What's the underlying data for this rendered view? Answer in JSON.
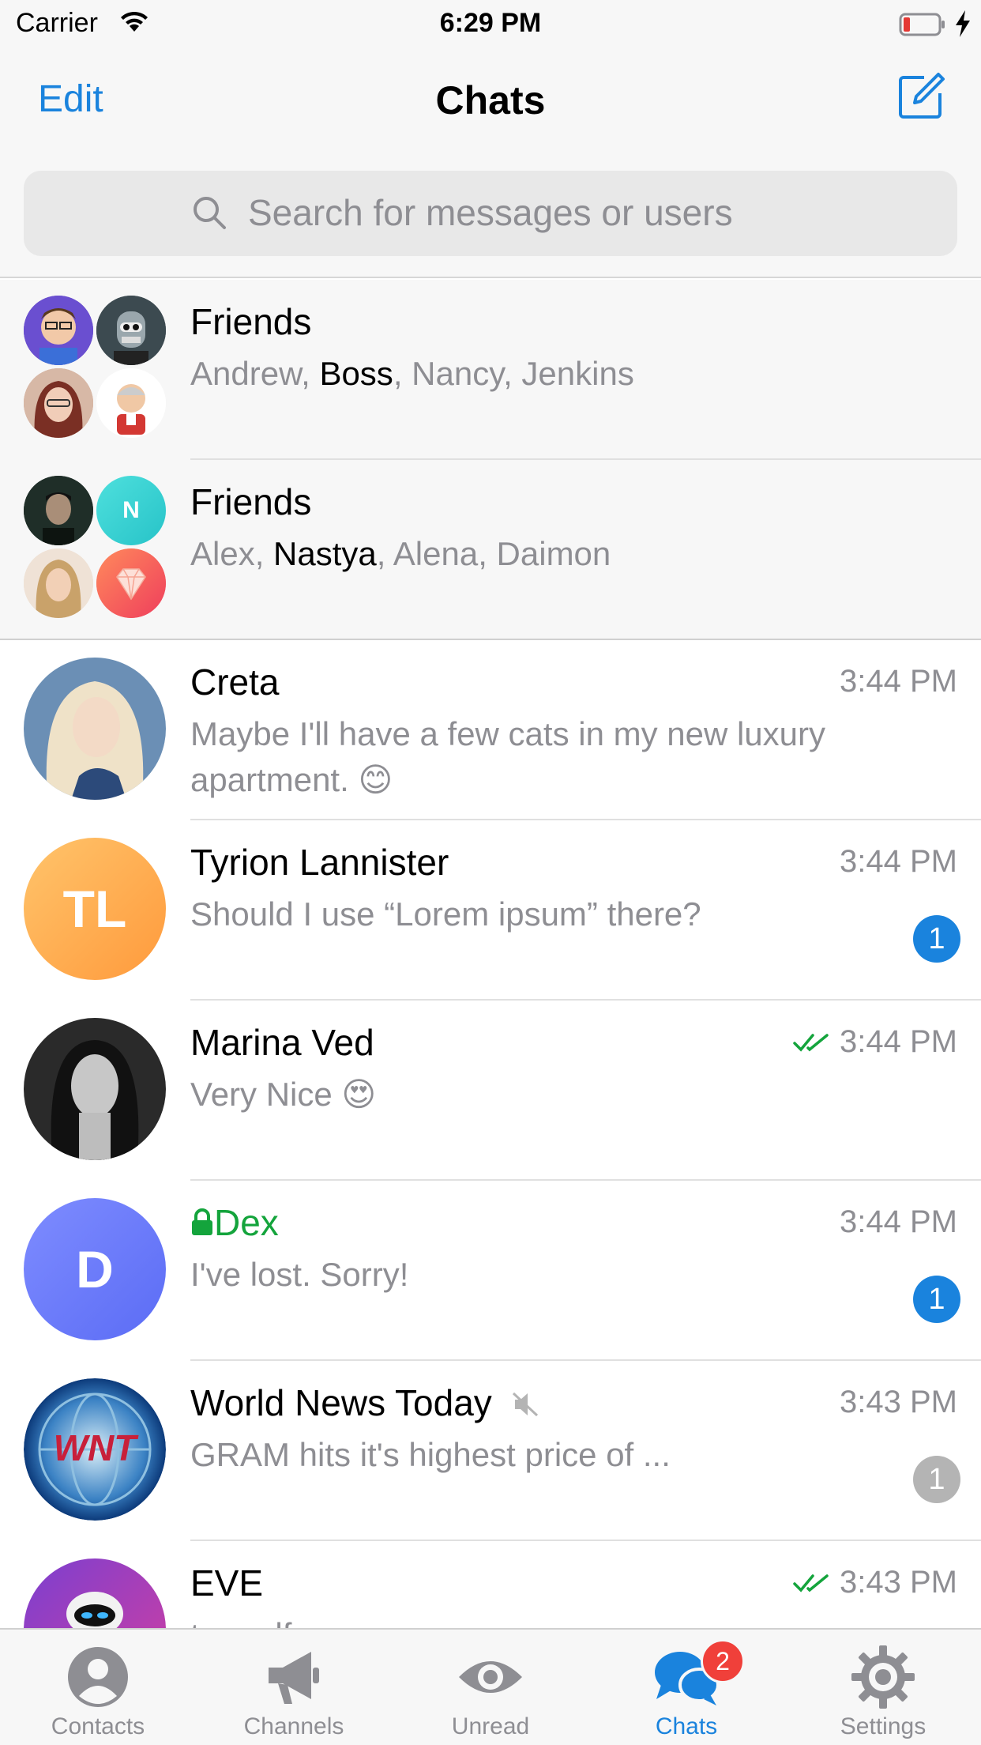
{
  "status_bar": {
    "carrier": "Carrier",
    "time": "6:29 PM",
    "battery_color": "#e53935"
  },
  "nav": {
    "edit_label": "Edit",
    "title": "Chats",
    "compose_icon": "compose-icon"
  },
  "search": {
    "placeholder": "Search for messages or users"
  },
  "groups": [
    {
      "name": "Friends",
      "members": [
        "Andrew, ",
        "Boss",
        ", Nancy, Jenkins"
      ],
      "avatar_icons": [
        "avatar-cartoon-man",
        "avatar-robot",
        "avatar-woman",
        "avatar-jenkins"
      ]
    },
    {
      "name": "Friends",
      "members": [
        "Alex, ",
        "Nastya",
        ", Alena, Daimon"
      ],
      "avatar_icons": [
        "avatar-man-dark",
        "N",
        "avatar-woman-blonde",
        "avatar-gem"
      ]
    }
  ],
  "chats": [
    {
      "name": "Creta",
      "time": "3:44 PM",
      "preview": "Maybe I'll have a few cats in my new luxury apartment. 😊"
    },
    {
      "name": "Tyrion Lannister",
      "initials": "TL",
      "time": "3:44 PM",
      "preview": "Should I use “Lorem ipsum” there?",
      "unread": "1"
    },
    {
      "name": "Marina Ved",
      "time": "3:44 PM",
      "preview": "Very Nice 😍",
      "read_status": "double-check"
    },
    {
      "name": "Dex",
      "initials": "D",
      "time": "3:44 PM",
      "preview": "I've lost. Sorry!",
      "unread": "1",
      "secret": true
    },
    {
      "name": "World News Today",
      "time": "3:43 PM",
      "preview": "GRAM hits it's highest price of ...",
      "unread": "1",
      "muted": true
    },
    {
      "name": "EVE",
      "time": "3:43 PM",
      "preview": "top.pdf",
      "read_status": "double-check"
    }
  ],
  "tabs": [
    {
      "label": "Contacts",
      "icon": "person-icon"
    },
    {
      "label": "Channels",
      "icon": "megaphone-icon"
    },
    {
      "label": "Unread",
      "icon": "eye-icon"
    },
    {
      "label": "Chats",
      "icon": "chat-bubbles-icon",
      "badge": "2",
      "active": true
    },
    {
      "label": "Settings",
      "icon": "gear-icon"
    }
  ],
  "colors": {
    "accent": "#1a83dd",
    "secret_green": "#14a43c",
    "badge_red": "#f0403a"
  }
}
